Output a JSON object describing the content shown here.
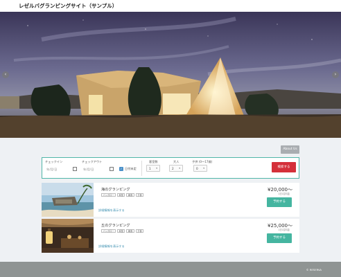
{
  "header": {
    "title": "レゼルバグランピングサイト（サンプル）"
  },
  "hero": {
    "prev_icon": "‹",
    "next_icon": "›"
  },
  "about": {
    "label": "About Us"
  },
  "search": {
    "checkin_label": "チェックイン",
    "checkout_label": "チェックアウト",
    "date_placeholder": "年/月/日",
    "undecided_label": "日付未定",
    "rooms_label": "客室数",
    "adults_label": "大人",
    "children_label": "子供 (0〜17歳)",
    "rooms_value": "1",
    "adults_value": "2",
    "children_value": "0",
    "caret": "▾",
    "check_mark": "✓",
    "search_button": "検索する"
  },
  "plans": [
    {
      "name": "海のグランピング",
      "tags": [
        "バンガロー",
        "和室",
        "朝食",
        "夕食"
      ],
      "price": "¥20,000〜",
      "price_note": "1泊1名料金",
      "detail_link": "詳細情報を表示する",
      "reserve_button": "予約する"
    },
    {
      "name": "丘のグランピング",
      "tags": [
        "バンガロー",
        "和室",
        "朝食",
        "夕食"
      ],
      "price": "¥25,000〜",
      "price_note": "1泊1名料金",
      "detail_link": "詳細情報を表示する",
      "reserve_button": "予約する"
    }
  ],
  "footer": {
    "copyright": "© RESERVA"
  },
  "colors": {
    "accent": "#45b5a0",
    "search_button": "#d4303a",
    "border": "#4fb5a8",
    "footer": "#8f9493"
  }
}
